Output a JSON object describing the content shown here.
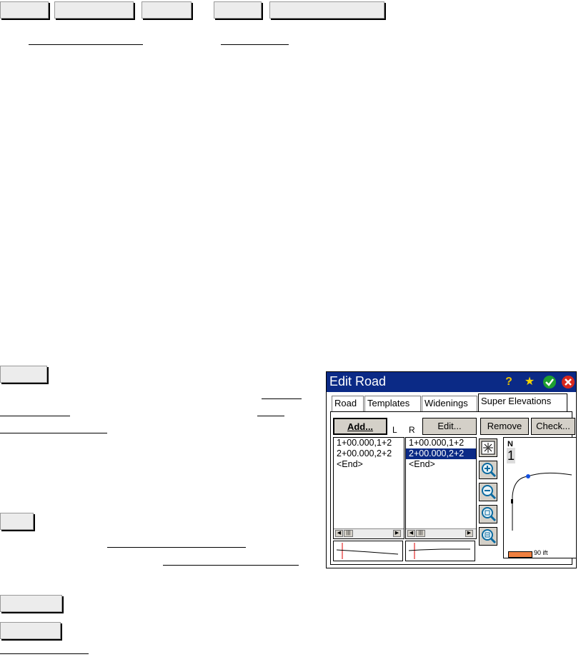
{
  "screenshot": {
    "title": "Edit Road",
    "tabs": [
      "Road",
      "Templates",
      "Widenings",
      "Super Elevations"
    ],
    "active_tab": "Super Elevations",
    "buttons": {
      "add": "Add...",
      "edit": "Edit...",
      "remove": "Remove",
      "check": "Check..."
    },
    "col_left_label": "L",
    "col_right_label": "R",
    "left_list": [
      "1+00.000,1+2",
      "2+00.000,2+2",
      "<End>"
    ],
    "right_list": [
      "1+00.000,1+2",
      "2+00.000,2+2",
      "<End>"
    ],
    "right_selected_index": 1,
    "north_label": "N",
    "scale_label": "90 ift",
    "colors": {
      "titlebar": "#0b2a86",
      "selection": "#0b2a86",
      "scale_bar": "#f08040"
    }
  }
}
